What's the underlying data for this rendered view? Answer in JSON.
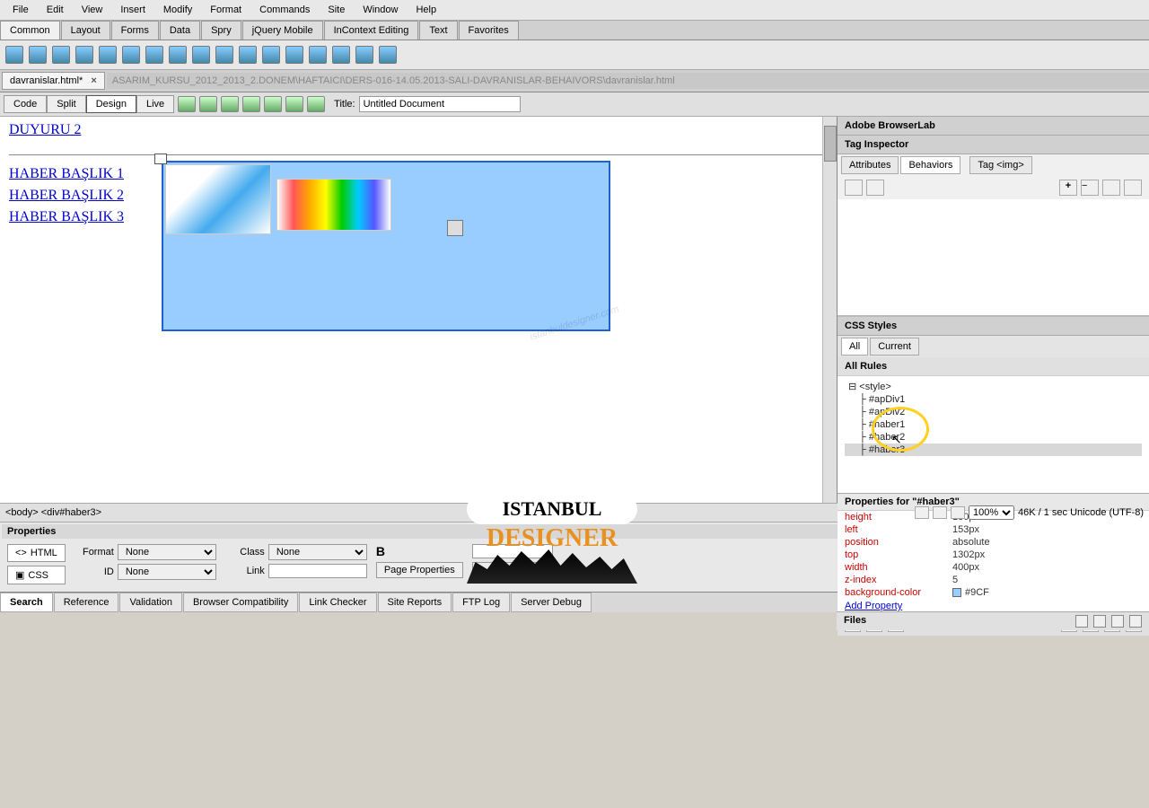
{
  "menus": [
    "File",
    "Edit",
    "View",
    "Insert",
    "Modify",
    "Format",
    "Commands",
    "Site",
    "Window",
    "Help"
  ],
  "toolbarTabs": [
    "Common",
    "Layout",
    "Forms",
    "Data",
    "Spry",
    "jQuery Mobile",
    "InContext Editing",
    "Text",
    "Favorites"
  ],
  "activeToolbarTab": "Common",
  "docTab": {
    "name": "davranislar.html*",
    "path": "ASARIM_KURSU_2012_2013_2.DONEM\\HAFTAICI\\DERS-016-14.05.2013-SALI-DAVRANISLAR-BEHAIVORS\\davranislar.html"
  },
  "viewModes": [
    "Code",
    "Split",
    "Design",
    "Live"
  ],
  "activeView": "Design",
  "titleLabel": "Title:",
  "titleValue": "Untitled Document",
  "content": {
    "duyuru": "DUYURU 2",
    "links": [
      "HABER BAŞLIK 1",
      "HABER BAŞLIK 2",
      "HABER BAŞLIK 3"
    ]
  },
  "breadcrumb": "<body>  <div#haber3>",
  "status": {
    "zoom": "100%",
    "info": "46K / 1 sec  Unicode (UTF-8)"
  },
  "propsTitle": "Properties",
  "propsModes": {
    "html": "HTML",
    "css": "CSS"
  },
  "formRow": {
    "formatLbl": "Format",
    "formatVal": "None",
    "classLbl": "Class",
    "classVal": "None",
    "idLbl": "ID",
    "idVal": "None",
    "linkLbl": "Link",
    "bold": "B"
  },
  "pagePropsBtn": "Page Properties",
  "bottomTabs": [
    "Search",
    "Reference",
    "Validation",
    "Browser Compatibility",
    "Link Checker",
    "Site Reports",
    "FTP Log",
    "Server Debug"
  ],
  "activeBottomTab": "Search",
  "rightPanel": {
    "browserlab": "Adobe BrowserLab",
    "tagInspector": "Tag Inspector",
    "tiTabs": [
      "Attributes",
      "Behaviors"
    ],
    "tiActive": "Behaviors",
    "tagLabel": "Tag <img>",
    "cssTitle": "CSS Styles",
    "cssTabs": [
      "All",
      "Current"
    ],
    "cssActive": "All",
    "allRules": "All Rules",
    "rules": [
      "<style>",
      "#apDiv1",
      "#apDiv2",
      "#haber1",
      "#haber2",
      "#haber3"
    ],
    "selectedRule": "#haber3",
    "propsForLabel": "Properties for \"#haber3\"",
    "props": [
      {
        "k": "height",
        "v": "180px"
      },
      {
        "k": "left",
        "v": "153px"
      },
      {
        "k": "position",
        "v": "absolute"
      },
      {
        "k": "top",
        "v": "1302px"
      },
      {
        "k": "width",
        "v": "400px"
      },
      {
        "k": "z-index",
        "v": "5"
      },
      {
        "k": "background-color",
        "v": "#9CF",
        "swatch": true
      }
    ],
    "addProp": "Add Property",
    "filesTitle": "Files"
  },
  "watermark": "istanbuldesigner.com",
  "logo": {
    "line1": "ISTANBUL",
    "line2": "DESIGNER"
  }
}
